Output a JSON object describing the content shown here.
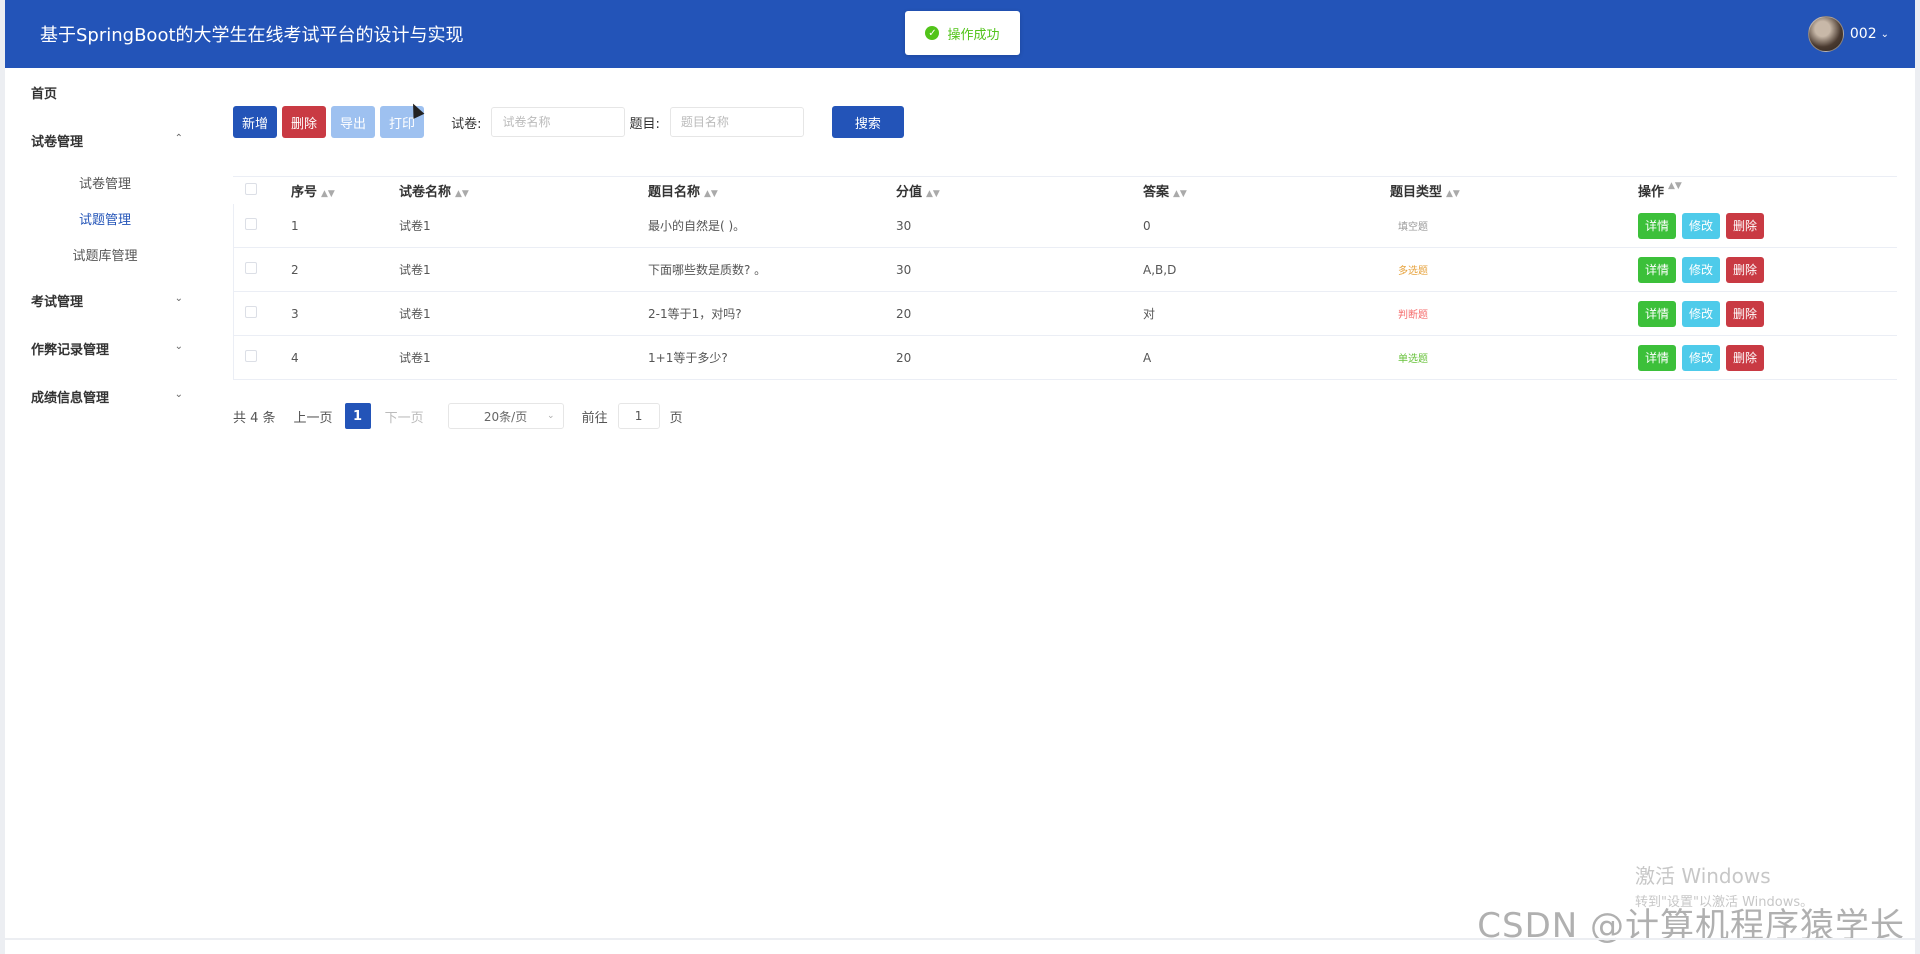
{
  "header": {
    "title": "基于SpringBoot的大学生在线考试平台的设计与实现",
    "toast": "操作成功",
    "username": "002"
  },
  "sidebar": {
    "home": "首页",
    "groups": [
      {
        "label": "试卷管理",
        "expanded": true,
        "items": [
          "试卷管理",
          "试题管理",
          "试题库管理"
        ],
        "active": 1
      },
      {
        "label": "考试管理",
        "expanded": false
      },
      {
        "label": "作弊记录管理",
        "expanded": false
      },
      {
        "label": "成绩信息管理",
        "expanded": false
      }
    ]
  },
  "toolbar": {
    "add": "新增",
    "delete": "删除",
    "export": "导出",
    "print": "打印",
    "paper_label": "试卷:",
    "paper_placeholder": "试卷名称",
    "question_label": "题目:",
    "question_placeholder": "题目名称",
    "search": "搜索"
  },
  "table": {
    "columns": [
      "序号",
      "试卷名称",
      "题目名称",
      "分值",
      "答案",
      "题目类型",
      "操作"
    ],
    "rows": [
      {
        "idx": "1",
        "paper": "试卷1",
        "name": "最小的自然是( )。",
        "score": "30",
        "answer": "0",
        "type": "填空题",
        "type_color": "#999999"
      },
      {
        "idx": "2",
        "paper": "试卷1",
        "name": "下面哪些数是质数? 。",
        "score": "30",
        "answer": "A,B,D",
        "type": "多选题",
        "type_color": "#e6a23c"
      },
      {
        "idx": "3",
        "paper": "试卷1",
        "name": "2-1等于1，对吗?",
        "score": "20",
        "answer": "对",
        "type": "判断题",
        "type_color": "#f56c6c"
      },
      {
        "idx": "4",
        "paper": "试卷1",
        "name": "1+1等于多少?",
        "score": "20",
        "answer": "A",
        "type": "单选题",
        "type_color": "#67c23a"
      }
    ],
    "ops": {
      "detail": "详情",
      "edit": "修改",
      "delete": "删除"
    }
  },
  "pager": {
    "total": "共 4 条",
    "prev": "上一页",
    "current": "1",
    "next": "下一页",
    "size": "20条/页",
    "goto": "前往",
    "jump_value": "1",
    "page_unit": "页"
  },
  "watermark": {
    "win_title": "激活 Windows",
    "win_sub": "转到\"设置\"以激活 Windows。",
    "csdn": "CSDN @计算机程序猿学长"
  }
}
